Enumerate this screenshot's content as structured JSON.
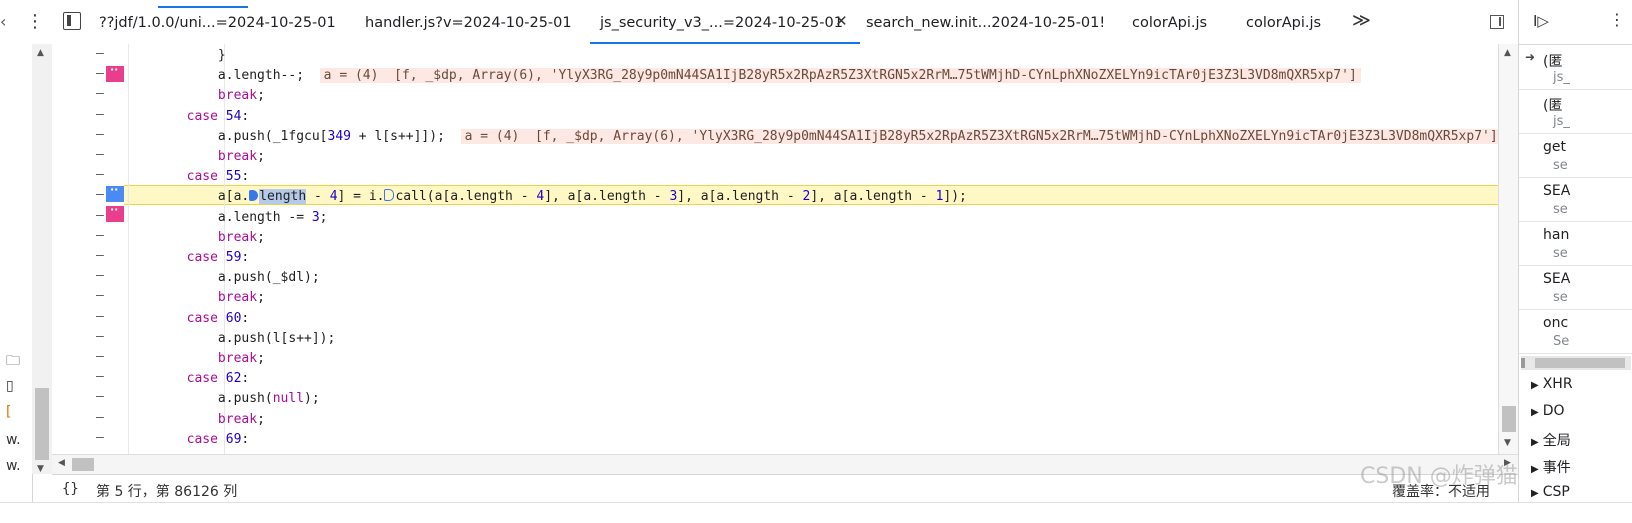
{
  "tabs": [
    {
      "label": "??jdf/1.0.0/uni...=2024-10-25-01"
    },
    {
      "label": "handler.js?v=2024-10-25-01"
    },
    {
      "label": "js_security_v3_...=2024-10-25-01",
      "active": true,
      "close": "✕"
    },
    {
      "label": "search_new.init...2024-10-25-01!"
    },
    {
      "label": "colorApi.js"
    },
    {
      "label": "colorApi.js"
    }
  ],
  "toolbar": {
    "more_tabs": "≫",
    "menu": "⋮",
    "nav_toggle": "◧"
  },
  "breakpoint_marks": {
    "pink": "··",
    "blue": "··"
  },
  "code_lines": [
    {
      "i": "            ",
      "t": [
        {
          "c": "}"
        }
      ]
    },
    {
      "i": "            ",
      "t": [
        {
          "c": "a.length--;"
        }
      ],
      "inline": "a = (4)  [f, _$dp, Array(6), 'YlyX3RG_28y9p0mN44SA1IjB28yR5x2RpAzR5Z3XtRGN5x2RrM…75tWMjhD-CYnLphXNoZXELYn9icTAr0jE3Z3L3VD8mQXR5xp7']"
    },
    {
      "i": "            ",
      "t": [
        {
          "c": "break",
          "k": "kw"
        },
        {
          "c": ";"
        }
      ]
    },
    {
      "i": "        ",
      "t": [
        {
          "c": "case",
          "k": "kw"
        },
        {
          "c": " "
        },
        {
          "c": "54",
          "k": "num"
        },
        {
          "c": ":"
        }
      ]
    },
    {
      "i": "            ",
      "t": [
        {
          "c": "a.push(_1fgcu["
        },
        {
          "c": "349",
          "k": "num"
        },
        {
          "c": " + l[s++]]);"
        }
      ],
      "inline": "a = (4)  [f, _$dp, Array(6), 'YlyX3RG_28y9p0mN44SA1IjB28yR5x2RpAzR5Z3XtRGN5x2RrM…75tWMjhD-CYnLphXNoZXELYn9icTAr0jE3Z3L3VD8mQXR5xp7']"
    },
    {
      "i": "            ",
      "t": [
        {
          "c": "break",
          "k": "kw"
        },
        {
          "c": ";"
        }
      ]
    },
    {
      "i": "        ",
      "t": [
        {
          "c": "case",
          "k": "kw"
        },
        {
          "c": " "
        },
        {
          "c": "55",
          "k": "num"
        },
        {
          "c": ":"
        }
      ]
    },
    {
      "i": "            ",
      "exec": true
    },
    {
      "i": "            ",
      "t": [
        {
          "c": "a.length -= "
        },
        {
          "c": "3",
          "k": "num"
        },
        {
          "c": ";"
        }
      ]
    },
    {
      "i": "            ",
      "t": [
        {
          "c": "break",
          "k": "kw"
        },
        {
          "c": ";"
        }
      ]
    },
    {
      "i": "        ",
      "t": [
        {
          "c": "case",
          "k": "kw"
        },
        {
          "c": " "
        },
        {
          "c": "59",
          "k": "num"
        },
        {
          "c": ":"
        }
      ]
    },
    {
      "i": "            ",
      "t": [
        {
          "c": "a.push(_$dl);"
        }
      ]
    },
    {
      "i": "            ",
      "t": [
        {
          "c": "break",
          "k": "kw"
        },
        {
          "c": ";"
        }
      ]
    },
    {
      "i": "        ",
      "t": [
        {
          "c": "case",
          "k": "kw"
        },
        {
          "c": " "
        },
        {
          "c": "60",
          "k": "num"
        },
        {
          "c": ":"
        }
      ]
    },
    {
      "i": "            ",
      "t": [
        {
          "c": "a.push(l[s++]);"
        }
      ]
    },
    {
      "i": "            ",
      "t": [
        {
          "c": "break",
          "k": "kw"
        },
        {
          "c": ";"
        }
      ]
    },
    {
      "i": "        ",
      "t": [
        {
          "c": "case",
          "k": "kw"
        },
        {
          "c": " "
        },
        {
          "c": "62",
          "k": "num"
        },
        {
          "c": ":"
        }
      ]
    },
    {
      "i": "            ",
      "t": [
        {
          "c": "a.push("
        },
        {
          "c": "null",
          "k": "kw"
        },
        {
          "c": ");"
        }
      ]
    },
    {
      "i": "            ",
      "t": [
        {
          "c": "break",
          "k": "kw"
        },
        {
          "c": ";"
        }
      ]
    },
    {
      "i": "        ",
      "t": [
        {
          "c": "case",
          "k": "kw"
        },
        {
          "c": " "
        },
        {
          "c": "69",
          "k": "num"
        },
        {
          "c": ":"
        }
      ]
    }
  ],
  "exec_line": {
    "pre": "a[a.",
    "sel": "length",
    "mid": " - ",
    "n1": "4",
    "mid2": "] = i.",
    "post": "call(a[a.length - ",
    "n2": "4",
    "p2": "], a[a.length - ",
    "n3": "3",
    "p3": "], a[a.length - ",
    "n4": "2",
    "p4": "], a[a.length - ",
    "n5": "1",
    "p5": "]);"
  },
  "gutter_dash": "–",
  "status": {
    "braces": "{}",
    "position": "第 5 行，第 86126 列",
    "coverage": "覆盖率：不适用"
  },
  "call_stack": [
    {
      "name": "(匿",
      "loc": "js_"
    },
    {
      "name": "(匿",
      "loc": "js_"
    },
    {
      "name": "get",
      "loc": "se"
    },
    {
      "name": "SEA",
      "loc": "se"
    },
    {
      "name": "han",
      "loc": "se"
    },
    {
      "name": "SEA",
      "loc": "se"
    },
    {
      "name": "onc",
      "loc": "Se"
    }
  ],
  "right_sections": [
    {
      "label": "XHR"
    },
    {
      "label": "DO"
    },
    {
      "label": "全局"
    },
    {
      "label": "事件"
    },
    {
      "label": "CSP"
    }
  ],
  "left_strip": [
    {
      "label": "w."
    },
    {
      "label": "w."
    }
  ],
  "right_toolbar": {
    "resume": "I▷",
    "dots": "⋮"
  },
  "watermark": "CSDN @炸弹猫"
}
